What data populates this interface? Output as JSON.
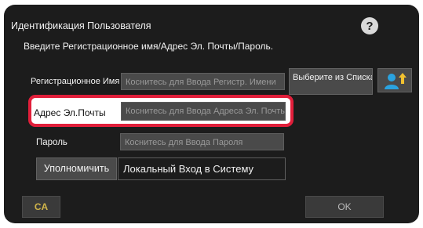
{
  "dialog": {
    "title": "Идентификация Пользователя",
    "help_icon": "?",
    "instruction": "Введите Регистрационное имя/Адрес Эл. Почты/Пароль."
  },
  "fields": {
    "login_name": {
      "label": "Регистрационное Имя",
      "placeholder": "Коснитесь для Ввода Регистр. Имени"
    },
    "email": {
      "label": "Адрес Эл.Почты",
      "placeholder": "Коснитесь для Ввода Адреса Эл. Почты"
    },
    "password": {
      "label": "Пароль",
      "placeholder": "Коснитесь для Ввода Пароля"
    }
  },
  "buttons": {
    "select_from_list": "Выберите из Списка",
    "user_list_icon": "user-list-icon",
    "authorize": "Уполномичить",
    "local_login": "Локальный Вход в Систему",
    "ca": "CA",
    "ok": "OK"
  },
  "colors": {
    "dialog_bg": "#1c1c1c",
    "field_bg": "#4a4a4a",
    "highlight": "#e11e3a",
    "ca_text": "#d1b54a",
    "user_icon": "#2aa3e0"
  }
}
